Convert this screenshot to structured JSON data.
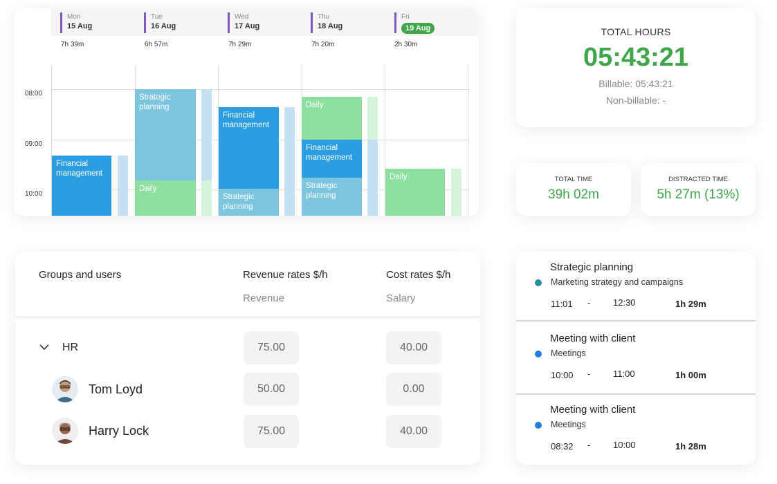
{
  "calendar": {
    "days": [
      {
        "name": "Mon",
        "date": "15 Aug",
        "total": "7h 39m",
        "today": false
      },
      {
        "name": "Tue",
        "date": "16 Aug",
        "total": "6h 57m",
        "today": false
      },
      {
        "name": "Wed",
        "date": "17 Aug",
        "total": "7h 29m",
        "today": false
      },
      {
        "name": "Thu",
        "date": "18 Aug",
        "total": "7h 20m",
        "today": false
      },
      {
        "name": "Fri",
        "date": "19 Aug",
        "total": "2h 30m",
        "today": true
      }
    ],
    "times": [
      "08:00",
      "09:00",
      "10:00"
    ],
    "events": {
      "mon_financial": "Financial management",
      "tue_strategic": "Strategic planning",
      "tue_daily": "Daily",
      "wed_financial": "Financial management",
      "wed_strategic": "Strategic planning",
      "thu_daily": "Daily",
      "thu_financial": "Financial management",
      "thu_strategic": "Strategic planning",
      "fri_daily": "Daily"
    },
    "colors": {
      "financial": "#2b9de0",
      "strategic": "#7dc5de",
      "daily": "#8ee09f",
      "today_badge": "#3fa64a",
      "day_marker": "#7e57c2"
    }
  },
  "total_hours": {
    "title": "TOTAL HOURS",
    "value": "05:43:21",
    "billable": "Billable: 05:43:21",
    "non_billable": "Non-billable: -"
  },
  "total_time": {
    "label": "TOTAL TIME",
    "value": "39h 02m"
  },
  "distracted_time": {
    "label": "DISTRACTED TIME",
    "value": "5h 27m (13%)"
  },
  "rates": {
    "col_groups": "Groups and users",
    "col_revenue": "Revenue rates  $/h",
    "col_revenue_sub": "Revenue",
    "col_cost": "Cost rates  $/h",
    "col_cost_sub": "Salary",
    "rows": [
      {
        "name": "HR",
        "revenue": "75.00",
        "cost": "40.00"
      },
      {
        "name": "Tom Loyd",
        "revenue": "50.00",
        "cost": "0.00"
      },
      {
        "name": "Harry Lock",
        "revenue": "75.00",
        "cost": "40.00"
      }
    ]
  },
  "activities": [
    {
      "title": "Strategic planning",
      "sub": "Marketing strategy and campaigns",
      "start": "11:01",
      "dash": "-",
      "end": "12:30",
      "duration": "1h 29m",
      "dot": "#2b8fa3"
    },
    {
      "title": "Meeting with client",
      "sub": "Meetings",
      "start": "10:00",
      "dash": "-",
      "end": "11:00",
      "duration": "1h 00m",
      "dot": "#1f7fe0"
    },
    {
      "title": "Meeting with client",
      "sub": "Meetings",
      "start": "08:32",
      "dash": "-",
      "end": "10:00",
      "duration": "1h 28m",
      "dot": "#1f7fe0"
    }
  ]
}
